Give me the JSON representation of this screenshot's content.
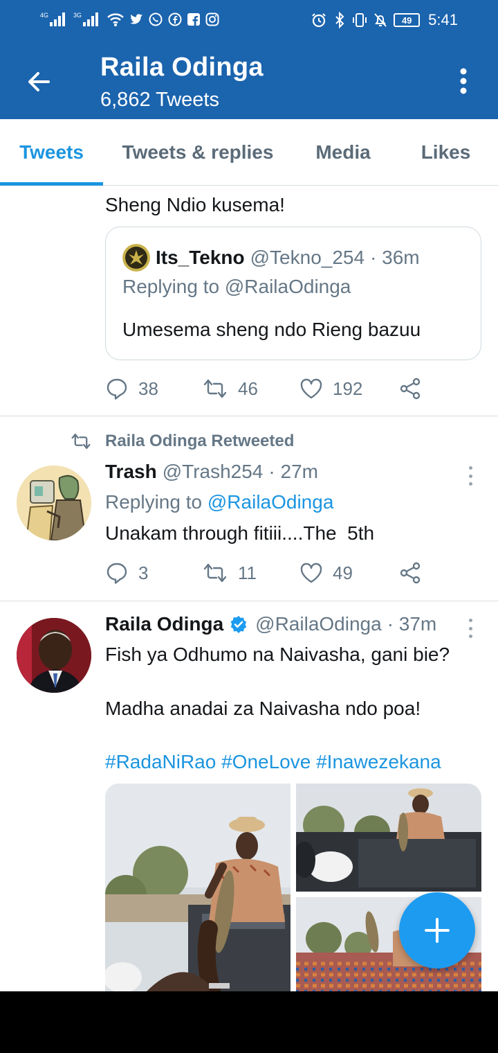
{
  "status_bar": {
    "time": "5:41",
    "battery": "49",
    "network_left": "4G",
    "network_right": "3G"
  },
  "app_bar": {
    "title": "Raila Odinga",
    "subtitle": "6,862 Tweets"
  },
  "tabs": [
    {
      "label": "Tweets",
      "active": true
    },
    {
      "label": "Tweets & replies",
      "active": false
    },
    {
      "label": "Media",
      "active": false
    },
    {
      "label": "Likes",
      "active": false
    }
  ],
  "tweets": [
    {
      "text": "Sheng Ndio kusema!",
      "quote": {
        "name": "Its_Tekno",
        "handle": "@Tekno_254",
        "time": "· 36m",
        "replying_to": "Replying to @RailaOdinga",
        "text": "Umesema sheng ndo Rieng bazuu"
      },
      "replies": "38",
      "retweets": "46",
      "likes": "192"
    },
    {
      "retweeted_by": "Raila Odinga Retweeted",
      "name": "Trash",
      "handle": "@Trash254",
      "time": "· 27m",
      "replying_prefix": "Replying to",
      "replying_handle": "@RailaOdinga",
      "text": "Unakam through fitiii....The  5th",
      "replies": "3",
      "retweets": "11",
      "likes": "49"
    },
    {
      "name": "Raila Odinga",
      "handle": "@RailaOdinga",
      "time": "· 37m",
      "text_line1": "Fish ya Odhumo na Naivasha, gani bie?",
      "text_line2": "Madha anadai za Naivasha ndo poa!",
      "hashtags": "#RadaNiRao #OneLove #Inawezekana"
    }
  ],
  "colors": {
    "app_bar": "#1b64ae",
    "accent": "#1b95e0",
    "muted": "#657786",
    "fab": "#1d9bf0"
  }
}
